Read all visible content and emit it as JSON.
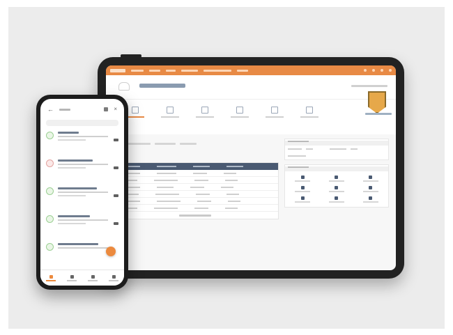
{
  "colors": {
    "accent": "#e88a45",
    "table_header": "#4a5a72",
    "badge": "#e6a84a",
    "phone_fab": "#ec8a3e"
  },
  "tablet": {
    "nav_icons": [
      "logo-icon"
    ],
    "tabs": [
      {
        "icon": "document-icon",
        "active": true
      },
      {
        "icon": "chart-icon",
        "active": false
      },
      {
        "icon": "list-icon",
        "active": false
      },
      {
        "icon": "calendar-icon",
        "active": false
      },
      {
        "icon": "folder-icon",
        "active": false
      },
      {
        "icon": "grid-icon",
        "active": false
      }
    ],
    "badge_icon": "shield-badge-icon"
  },
  "phone": {
    "back_icon": "back-arrow-icon",
    "mic_icon": "mic-icon",
    "close_icon": "close-icon",
    "list_items": [
      {
        "status": "green"
      },
      {
        "status": "red"
      },
      {
        "status": "green"
      },
      {
        "status": "green"
      },
      {
        "status": "green"
      }
    ],
    "tabbar": [
      {
        "icon": "home-icon",
        "active": true
      },
      {
        "icon": "grid-icon",
        "active": false
      },
      {
        "icon": "phone-icon",
        "active": false
      },
      {
        "icon": "menu-icon",
        "active": false
      }
    ]
  }
}
